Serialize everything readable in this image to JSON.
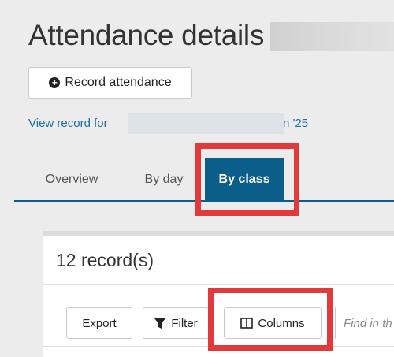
{
  "header": {
    "title": "Attendance details for"
  },
  "actions": {
    "record_attendance": "Record attendance"
  },
  "link": {
    "prefix": "View record for",
    "suffix": "n '25"
  },
  "tabs": [
    {
      "label": "Overview"
    },
    {
      "label": "By day"
    },
    {
      "label": "By class",
      "active": true
    }
  ],
  "table": {
    "count_label": "12 record(s)",
    "toolbar": {
      "export_label": "Export",
      "filter_label": "Filter",
      "columns_label": "Columns",
      "find_placeholder": "Find in th"
    }
  },
  "colors": {
    "accent": "#0b5e8a",
    "highlight": "#e2393a",
    "link": "#1a6fa3"
  },
  "icons": [
    "plus-circle-icon",
    "filter-icon",
    "columns-icon"
  ]
}
